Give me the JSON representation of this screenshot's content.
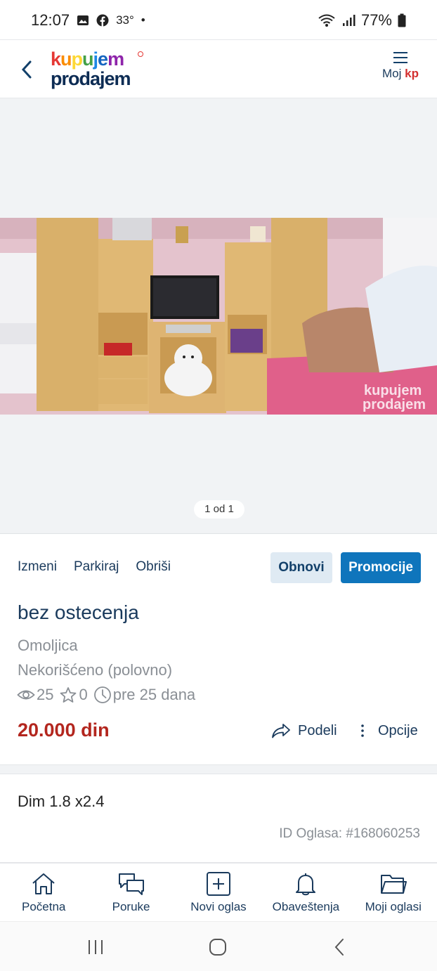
{
  "status_bar": {
    "time": "12:07",
    "temperature": "33°",
    "dot": "•",
    "battery": "77%"
  },
  "header": {
    "logo_line1": "kupujem",
    "logo_line2": "prodajem",
    "menu_label_prefix": "Moj",
    "menu_label_suffix": "kp"
  },
  "gallery": {
    "counter": "1 od 1",
    "watermark_line1": "kupujem",
    "watermark_line2": "prodajem"
  },
  "actions": {
    "edit": "Izmeni",
    "park": "Parkiraj",
    "delete": "Obriši",
    "renew": "Obnovi",
    "promote": "Promocije"
  },
  "ad": {
    "title": "bez ostecenja",
    "location": "Omoljica",
    "condition": "Nekorišćeno (polovno)",
    "views": "25",
    "favorites": "0",
    "age": "pre 25 dana",
    "price": "20.000 din",
    "share_label": "Podeli",
    "options_label": "Opcije",
    "description": "Dim 1.8 x2.4",
    "ad_id": "ID Oglasa: #168060253"
  },
  "bottom_nav": {
    "items": [
      {
        "label": "Početna",
        "icon": "home-icon"
      },
      {
        "label": "Poruke",
        "icon": "messages-icon"
      },
      {
        "label": "Novi oglas",
        "icon": "plus-square-icon"
      },
      {
        "label": "Obaveštenja",
        "icon": "bell-icon"
      },
      {
        "label": "Moji oglasi",
        "icon": "folder-icon"
      }
    ]
  },
  "colors": {
    "accent": "#0f75bc",
    "price": "#b3261e",
    "text_primary": "#1a3a5c",
    "text_muted": "#8a8f95"
  }
}
